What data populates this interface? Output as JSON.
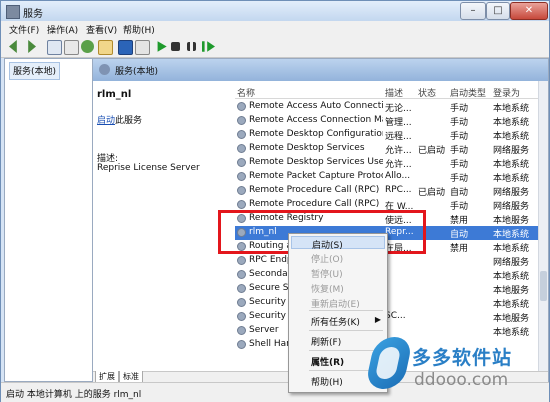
{
  "window": {
    "title": "服务"
  },
  "window_buttons": {
    "minimize": "–",
    "maximize": "□",
    "close": "✕"
  },
  "menu": [
    "文件(F)",
    "操作(A)",
    "查看(V)",
    "帮助(H)"
  ],
  "toolbar": {
    "icons": [
      "back-icon",
      "forward-icon",
      "console-tree-icon",
      "properties-icon",
      "refresh-icon",
      "export-icon",
      "help-icon",
      "view-icon",
      "start-icon",
      "stop-icon",
      "pause-icon",
      "restart-icon"
    ]
  },
  "left_pane": {
    "item": "服务(本地)"
  },
  "right_pane": {
    "header": "服务(本地)",
    "service_name": "rlm_nl",
    "start_link": "启动",
    "start_suffix": "此服务",
    "desc_label": "描述:",
    "desc_value": "Reprise License Server"
  },
  "table": {
    "columns": [
      "名称",
      "描述",
      "状态",
      "启动类型",
      "登录为"
    ],
    "rows": [
      {
        "name": "Remote Access Auto Connectio...",
        "desc": "无论...",
        "status": "",
        "startup": "手动",
        "logon": "本地系统"
      },
      {
        "name": "Remote Access Connection Ma...",
        "desc": "管理...",
        "status": "",
        "startup": "手动",
        "logon": "本地系统"
      },
      {
        "name": "Remote Desktop Configuration",
        "desc": "远程...",
        "status": "",
        "startup": "手动",
        "logon": "本地系统"
      },
      {
        "name": "Remote Desktop Services",
        "desc": "允许...",
        "status": "已启动",
        "startup": "手动",
        "logon": "网络服务"
      },
      {
        "name": "Remote Desktop Services User...",
        "desc": "允许...",
        "status": "",
        "startup": "手动",
        "logon": "本地系统"
      },
      {
        "name": "Remote Packet Capture Protoc...",
        "desc": "Allo...",
        "status": "",
        "startup": "手动",
        "logon": "本地系统"
      },
      {
        "name": "Remote Procedure Call (RPC)",
        "desc": "RPC...",
        "status": "已启动",
        "startup": "自动",
        "logon": "网络服务"
      },
      {
        "name": "Remote Procedure Call (RPC) ...",
        "desc": "在 W...",
        "status": "",
        "startup": "手动",
        "logon": "网络服务"
      },
      {
        "name": "Remote Registry",
        "desc": "使远...",
        "status": "",
        "startup": "禁用",
        "logon": "本地服务"
      },
      {
        "name": "rlm_nl",
        "desc": "Repr...",
        "status": "",
        "startup": "自动",
        "logon": "本地系统"
      },
      {
        "name": "Routing an",
        "desc": "在局...",
        "status": "",
        "startup": "禁用",
        "logon": "本地系统"
      },
      {
        "name": "RPC Endpo",
        "desc": "",
        "status": "",
        "startup": "",
        "logon": "网络服务"
      },
      {
        "name": "Secondary",
        "desc": "",
        "status": "",
        "startup": "",
        "logon": "本地系统"
      },
      {
        "name": "Secure Soc",
        "desc": "",
        "status": "",
        "startup": "",
        "logon": "本地服务"
      },
      {
        "name": "Security Ac",
        "desc": "",
        "status": "",
        "startup": "",
        "logon": "本地系统"
      },
      {
        "name": "Security Ce",
        "desc": "SC...",
        "status": "",
        "startup": "",
        "logon": "本地服务"
      },
      {
        "name": "Server",
        "desc": "",
        "status": "",
        "startup": "",
        "logon": "本地系统"
      },
      {
        "name": "Shell Hard",
        "desc": "",
        "status": "",
        "startup": "",
        "logon": ""
      }
    ]
  },
  "context_menu": {
    "items": [
      {
        "label": "启动(S)",
        "state": "highlighted"
      },
      {
        "label": "停止(O)",
        "state": "disabled"
      },
      {
        "label": "暂停(U)",
        "state": "disabled"
      },
      {
        "label": "恢复(M)",
        "state": "disabled"
      },
      {
        "label": "重新启动(E)",
        "state": "disabled"
      },
      {
        "label": "所有任务(K)",
        "state": "normal",
        "submenu": "▶"
      },
      {
        "label": "刷新(F)",
        "state": "normal"
      },
      {
        "label": "属性(R)",
        "state": "bold"
      },
      {
        "label": "帮助(H)",
        "state": "normal"
      }
    ]
  },
  "tabs": [
    "扩展",
    "标准"
  ],
  "status_bar": "启动 本地计算机 上的服务 rlm_nl",
  "watermark": {
    "brand": "多多软件站",
    "url": "ddooo.com"
  },
  "colors": {
    "selection": "#3d7ad6",
    "highlight_box": "#e3161c",
    "header_gradient": "#93b3db"
  }
}
